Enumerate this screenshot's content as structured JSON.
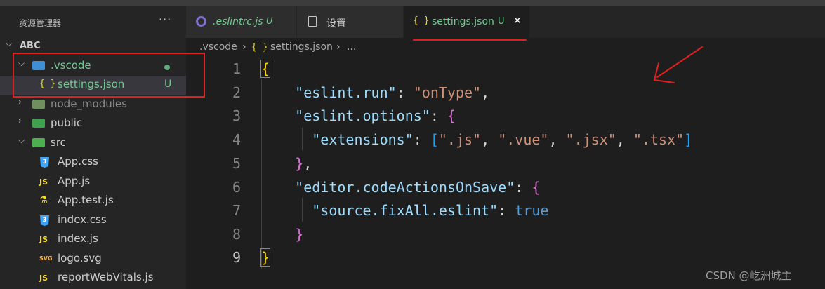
{
  "explorer": {
    "title": "资源管理器",
    "more": "···",
    "root": "ABC",
    "items": [
      {
        "label": ".vscode",
        "status": "dot"
      },
      {
        "label": "settings.json",
        "status": "U"
      },
      {
        "label": "node_modules"
      },
      {
        "label": "public"
      },
      {
        "label": "src"
      },
      {
        "label": "App.css"
      },
      {
        "label": "App.js"
      },
      {
        "label": "App.test.js"
      },
      {
        "label": "index.css"
      },
      {
        "label": "index.js"
      },
      {
        "label": "logo.svg"
      },
      {
        "label": "reportWebVitals.js"
      }
    ]
  },
  "tabs": [
    {
      "label": ".eslintrc.js",
      "mark": "U"
    },
    {
      "label": "设置"
    },
    {
      "label": "settings.json",
      "mark": "U",
      "close": "✕"
    }
  ],
  "breadcrumb": [
    ".vscode",
    "settings.json",
    "..."
  ],
  "code": {
    "line_numbers": [
      "1",
      "2",
      "3",
      "4",
      "5",
      "6",
      "7",
      "8",
      "9"
    ],
    "k_run": "\"eslint.run\"",
    "v_run": "\"onType\"",
    "k_options": "\"eslint.options\"",
    "k_ext": "\"extensions\"",
    "v_js": "\".js\"",
    "v_vue": "\".vue\"",
    "v_jsx": "\".jsx\"",
    "v_tsx": "\".tsx\"",
    "k_actions": "\"editor.codeActionsOnSave\"",
    "k_fix": "\"source.fixAll.eslint\"",
    "v_true": "true"
  },
  "watermark": "CSDN @屹洲城主",
  "colors": {
    "annotation": "#e02020",
    "untracked": "#73c991"
  }
}
